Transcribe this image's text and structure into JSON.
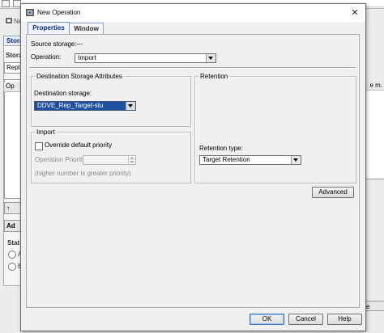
{
  "background": {
    "tab_label": "Stora",
    "storage_label": "Stora",
    "field_value": "Repli",
    "column_header": "Op",
    "right_column_header": "e m.",
    "add_button": "Ad",
    "status_label": "Stat",
    "radio_a": "A",
    "radio_b": "E",
    "right_button": "e"
  },
  "dialog": {
    "title": "New Operation",
    "close_symbol": "✕",
    "tabs": [
      {
        "label": "Properties",
        "active": true
      },
      {
        "label": "Window",
        "active": false
      }
    ],
    "source_storage": {
      "label": "Source storage:",
      "value": "---"
    },
    "operation": {
      "label": "Operation:",
      "value": "Import"
    },
    "destination_group": {
      "title": "Destination Storage Attributes",
      "label": "Destination storage:",
      "value": "DDVE_Rep_Target-stu"
    },
    "retention_group": {
      "title": "Retention",
      "label": "Retention type:",
      "value": "Target Retention"
    },
    "import_group": {
      "title": "Import",
      "override_label": "Override default priority",
      "override_checked": false,
      "priority_label": "Operation Priority",
      "priority_value": "",
      "hint": "(higher number is greater priority)"
    },
    "buttons": {
      "advanced": "Advanced",
      "ok": "OK",
      "cancel": "Cancel",
      "help": "Help"
    }
  },
  "colors": {
    "selection": "#1f4fa0",
    "tab_text": "#0a2f7f",
    "default_button_border": "#3b74c4"
  }
}
